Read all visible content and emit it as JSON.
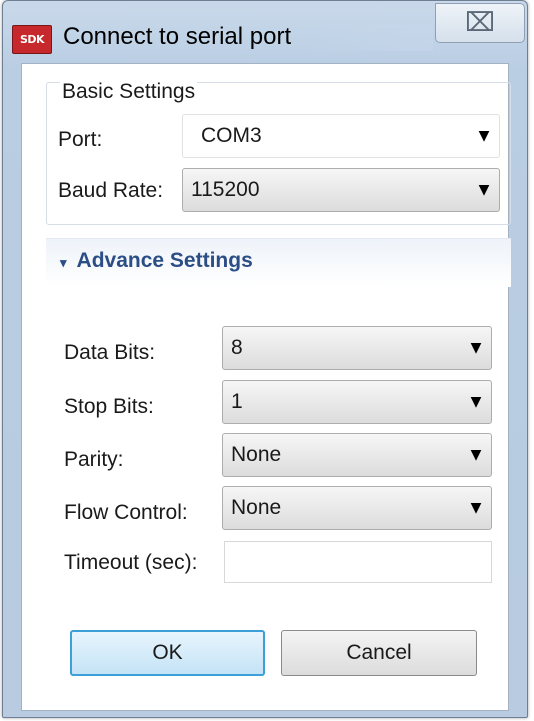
{
  "window": {
    "title": "Connect to serial port",
    "app_icon_text": "SDK",
    "close_symbol": "⌧"
  },
  "basic": {
    "title": "Basic Settings",
    "port_label": "Port:",
    "port_value": "COM3",
    "baud_label": "Baud Rate:",
    "baud_value": "115200"
  },
  "advance": {
    "title": "Advance Settings",
    "toggle_icon": "▾",
    "data_bits_label": "Data Bits:",
    "data_bits_value": "8",
    "stop_bits_label": "Stop Bits:",
    "stop_bits_value": "1",
    "parity_label": "Parity:",
    "parity_value": "None",
    "flow_label": "Flow Control:",
    "flow_value": "None",
    "timeout_label": "Timeout (sec):",
    "timeout_value": ""
  },
  "buttons": {
    "ok": "OK",
    "cancel": "Cancel"
  },
  "icons": {
    "dropdown": "chevron-down-icon",
    "close": "close-icon",
    "collapse": "triangle-down-icon"
  },
  "colors": {
    "section_title": "#2c4e86",
    "default_button_border": "#3c9fd7"
  }
}
